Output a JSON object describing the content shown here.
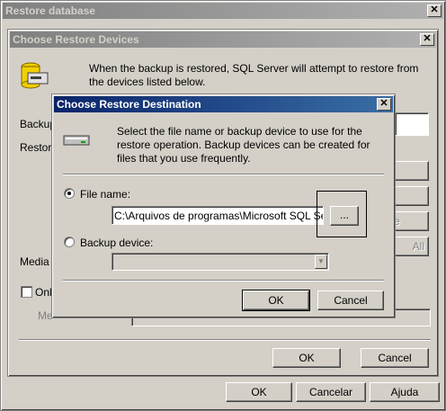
{
  "restore_window": {
    "title": "Restore database",
    "ok_label": "OK",
    "cancel_label": "Cancelar",
    "help_label": "Ajuda"
  },
  "devices_dialog": {
    "title": "Choose Restore Devices",
    "description": "When the backup is restored, SQL Server will attempt to restore from the devices listed below.",
    "backup_label_partial": "Backup",
    "restore_label_partial": "Restore",
    "media_label_partial": "Media v",
    "only_checkbox_partial": "Onl",
    "obscured_label_partial": "Me",
    "right_button_partial_1": "e",
    "right_button_partial_2": "All",
    "ok_label": "OK",
    "cancel_label": "Cancel"
  },
  "destination_dialog": {
    "title": "Choose Restore Destination",
    "description": "Select the file name or backup device to use for the restore operation.  Backup devices can be created for files that you use frequently.",
    "file_name_label": "File name:",
    "file_name_value": "C:\\Arquivos de programas\\Microsoft SQL Server",
    "browse_label": "...",
    "backup_device_label": "Backup device:",
    "backup_device_value": "",
    "selected_option": "File name",
    "ok_label": "OK",
    "cancel_label": "Cancel"
  },
  "colors": {
    "active_title": "#0a246a",
    "inactive_title": "#808080",
    "face": "#d4d0c8"
  }
}
